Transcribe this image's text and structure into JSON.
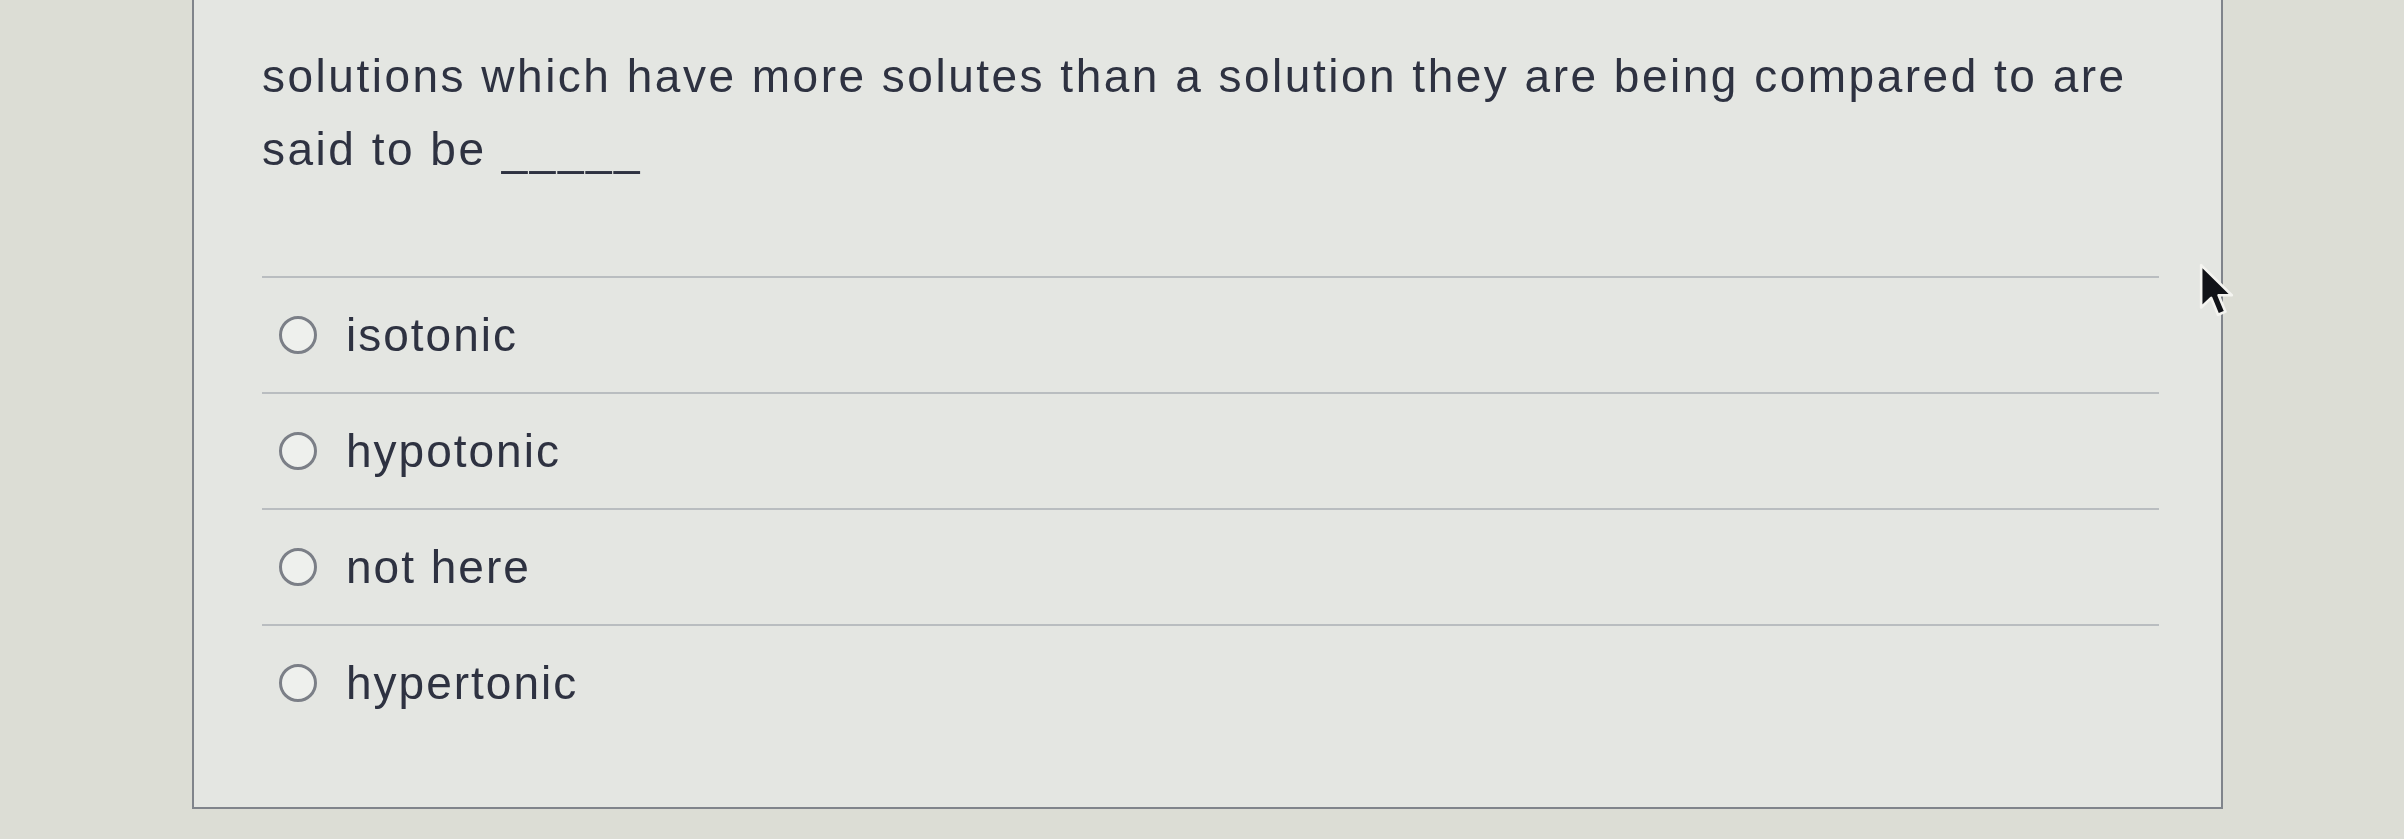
{
  "question": {
    "text": "solutions which have more solutes than a solution they are being compared to are said to be _____"
  },
  "options": [
    {
      "label": "isotonic",
      "selected": false
    },
    {
      "label": "hypotonic",
      "selected": false
    },
    {
      "label": "not here",
      "selected": false
    },
    {
      "label": "hypertonic",
      "selected": false
    }
  ]
}
